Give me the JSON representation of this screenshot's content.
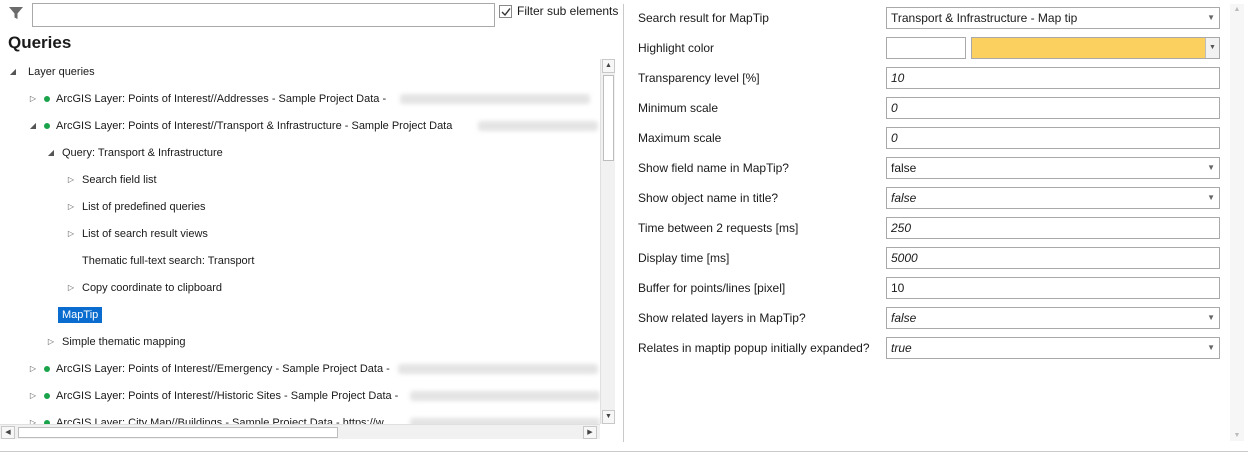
{
  "filter": {
    "value": "",
    "checkbox_checked": true,
    "checkbox_label": "Filter sub elements"
  },
  "queries_title": "Queries",
  "tree": [
    {
      "label": "Layer queries",
      "indent": 0,
      "expander": "expanded",
      "dot": false
    },
    {
      "label": "ArcGIS Layer: Points of Interest//Addresses - Sample Project Data -",
      "indent": 1,
      "expander": "collapsed",
      "dot": true
    },
    {
      "label": "ArcGIS Layer: Points of Interest//Transport & Infrastructure - Sample Project Data",
      "indent": 1,
      "expander": "expanded",
      "dot": true
    },
    {
      "label": "Query: Transport & Infrastructure",
      "indent": 2,
      "expander": "expanded",
      "dot": false
    },
    {
      "label": "Search field list",
      "indent": 3,
      "expander": "collapsed",
      "dot": false
    },
    {
      "label": "List of predefined queries",
      "indent": 3,
      "expander": "collapsed",
      "dot": false
    },
    {
      "label": "List of search result views",
      "indent": 3,
      "expander": "collapsed",
      "dot": false
    },
    {
      "label": "Thematic full-text search: Transport",
      "indent": 3,
      "expander": "none",
      "dot": false
    },
    {
      "label": "Copy coordinate to clipboard",
      "indent": 3,
      "expander": "collapsed",
      "dot": false
    },
    {
      "label": "MapTip",
      "indent": 2,
      "expander": "none",
      "dot": false,
      "selected": true
    },
    {
      "label": "Simple thematic mapping",
      "indent": 2,
      "expander": "collapsed",
      "dot": false
    },
    {
      "label": "ArcGIS Layer: Points of Interest//Emergency - Sample Project Data -",
      "indent": 1,
      "expander": "collapsed",
      "dot": true
    },
    {
      "label": "ArcGIS Layer: Points of Interest//Historic Sites - Sample Project Data -",
      "indent": 1,
      "expander": "collapsed",
      "dot": true
    },
    {
      "label": "ArcGIS Layer: City Map//Buildings - Sample Project Data - https://w",
      "indent": 1,
      "expander": "collapsed",
      "dot": true
    }
  ],
  "properties": [
    {
      "label": "Search result for MapTip",
      "type": "select",
      "value": "Transport & Infrastructure - Map tip",
      "italic": false
    },
    {
      "label": "Highlight color",
      "type": "color",
      "value": "",
      "color": "#fcd05f"
    },
    {
      "label": "Transparency level [%]",
      "type": "text",
      "value": "10",
      "italic": true
    },
    {
      "label": "Minimum scale",
      "type": "text",
      "value": "0",
      "italic": true
    },
    {
      "label": "Maximum scale",
      "type": "text",
      "value": "0",
      "italic": true
    },
    {
      "label": "Show field name in MapTip?",
      "type": "select",
      "value": "false",
      "italic": false
    },
    {
      "label": "Show object name in title?",
      "type": "select",
      "value": "false",
      "italic": true
    },
    {
      "label": "Time between 2 requests [ms]",
      "type": "text",
      "value": "250",
      "italic": true
    },
    {
      "label": "Display time [ms]",
      "type": "text",
      "value": "5000",
      "italic": true
    },
    {
      "label": "Buffer for points/lines [pixel]",
      "type": "text",
      "value": "10",
      "italic": false
    },
    {
      "label": "Show related layers in MapTip?",
      "type": "select",
      "value": "false",
      "italic": true
    },
    {
      "label": "Relates in maptip popup initially expanded?",
      "type": "select",
      "value": "true",
      "italic": true
    }
  ],
  "colors": {
    "selection": "#0a6ccf",
    "status_dot": "#1aa34a",
    "highlight": "#fcd05f"
  }
}
